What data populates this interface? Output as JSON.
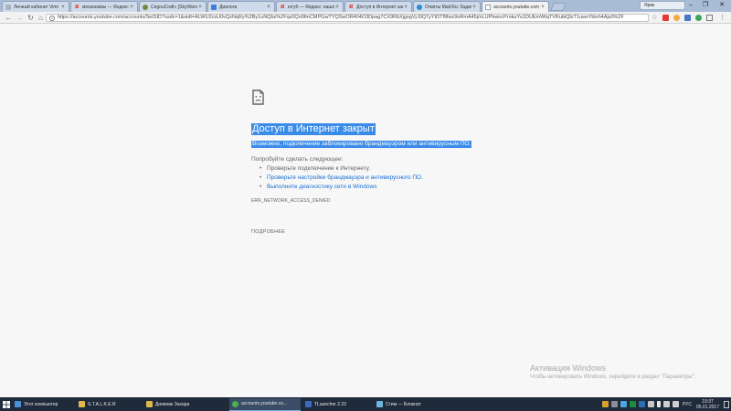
{
  "tabs": [
    {
      "title": "Личный кабинет Vimr",
      "favicon": "generic-page-icon",
      "active": false
    },
    {
      "title": "механизмы — Яндекс",
      "favicon": "yandex-icon",
      "active": false
    },
    {
      "title": "CegouCraft» [SkyWars]",
      "favicon": "game-icon",
      "active": false
    },
    {
      "title": "Диалоги",
      "favicon": "chat-icon",
      "active": false
    },
    {
      "title": "ютуб — Яндекс: нашлос",
      "favicon": "yandex-icon",
      "active": false
    },
    {
      "title": "Доступ в Интернет зак",
      "favicon": "yandex-icon",
      "active": false
    },
    {
      "title": "Ответы Mail.Ru: Задать",
      "favicon": "mail-icon",
      "active": false
    },
    {
      "title": "accounts.youtube.com",
      "favicon": "blank-page-icon",
      "active": true
    }
  ],
  "window": {
    "user": "Ярик"
  },
  "address_bar": {
    "url": "https://accounts.youtube.com/accounts/SetSID?ssdc=1&sidt=ALWU2csU0vQzNqRy%2By1uNQbz%2Fqz0Qo9fmCMPGwTYQSwOR404O3Dpag7CX9RbXjgxgVj.I9Q7yYtDTf9fwz9oRmA45j/nLUPhwncPrnkuYu1DUEmWtqTVRubiQlzT1uwsYbtvh4Ajs0%2F"
  },
  "error": {
    "title": "Доступ в Интернет закрыт",
    "summary": "Возможно, подключение заблокировано брандмауэром или антивирусным ПО.",
    "try_label": "Попробуйте сделать следующее:",
    "suggestions": [
      {
        "text": "Проверьте подключение к Интернету.",
        "link": false
      },
      {
        "text": "Проверьте настройки брандмауэра и антивирусного ПО.",
        "link": true
      },
      {
        "text": "Выполните диагностику сети в Windows",
        "link": true
      }
    ],
    "code": "ERR_NETWORK_ACCESS_DENIED",
    "details_button": "ПОДРОБНЕЕ"
  },
  "activation": {
    "title": "Активация Windows",
    "subtitle": "Чтобы активировать Windows, перейдите в раздел \"Параметры\"."
  },
  "taskbar": {
    "items": [
      {
        "label": "Этот компьютер",
        "icon": "computer-icon",
        "color": "#4a90d9",
        "active": false
      },
      {
        "label": "S.T.A.L.K.E.R",
        "icon": "folder-icon",
        "color": "#e0b84a",
        "active": false
      },
      {
        "label": "Дневник Захара",
        "icon": "folder-icon",
        "color": "#e0b84a",
        "active": false
      },
      {
        "label": "accounts.youtube.co...",
        "icon": "chrome-icon",
        "color": "#4caf50",
        "active": true
      },
      {
        "label": "TLauncher 2.22",
        "icon": "tlauncher-icon",
        "color": "#3b6cc2",
        "active": false
      },
      {
        "label": "Стим — Блокнот",
        "icon": "notepad-icon",
        "color": "#6fb3e0",
        "active": false
      }
    ],
    "lang": "РУС",
    "time": "19:37",
    "date": "05.01.2017"
  },
  "colors": {
    "selection": "#3b8ce8",
    "link": "#1a6fd4",
    "taskbar": "#1f2a3a",
    "tabstrip": "#a9bcd6"
  }
}
